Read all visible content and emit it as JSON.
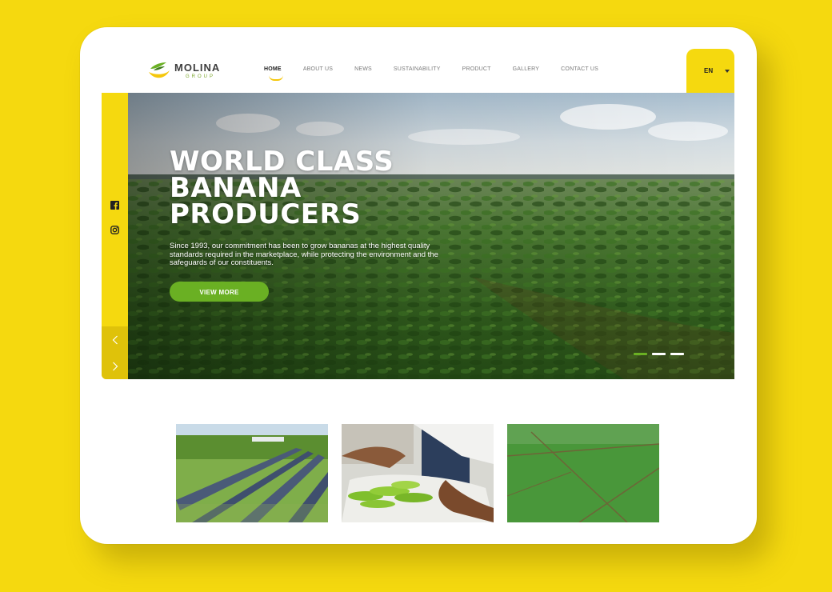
{
  "brand": {
    "name": "MOLINA",
    "sub": "GROUP",
    "colors": {
      "yellow": "#f5d90f",
      "green": "#6ab023",
      "dark": "#3d3d3d"
    }
  },
  "nav": {
    "items": [
      "HOME",
      "ABOUT US",
      "NEWS",
      "SUSTAINABILITY",
      "PRODUCT",
      "GALLERY",
      "CONTACT US"
    ],
    "active": "HOME"
  },
  "language": {
    "label": "EN"
  },
  "social": {
    "icons": [
      "facebook-icon",
      "instagram-icon"
    ]
  },
  "hero": {
    "title_lines": [
      "WORLD CLASS",
      "BANANA",
      "PRODUCERS"
    ],
    "description": "Since 1993, our commitment has been to grow bananas at the highest quality standards required in the marketplace, while protecting the environment and the safeguards of our constituents.",
    "button": "VIEW MORE",
    "slides": 3,
    "active_slide": 1
  },
  "thumbnails": [
    "solar-panels-field",
    "hands-packing-bananas",
    "aerial-plantation-plots"
  ]
}
